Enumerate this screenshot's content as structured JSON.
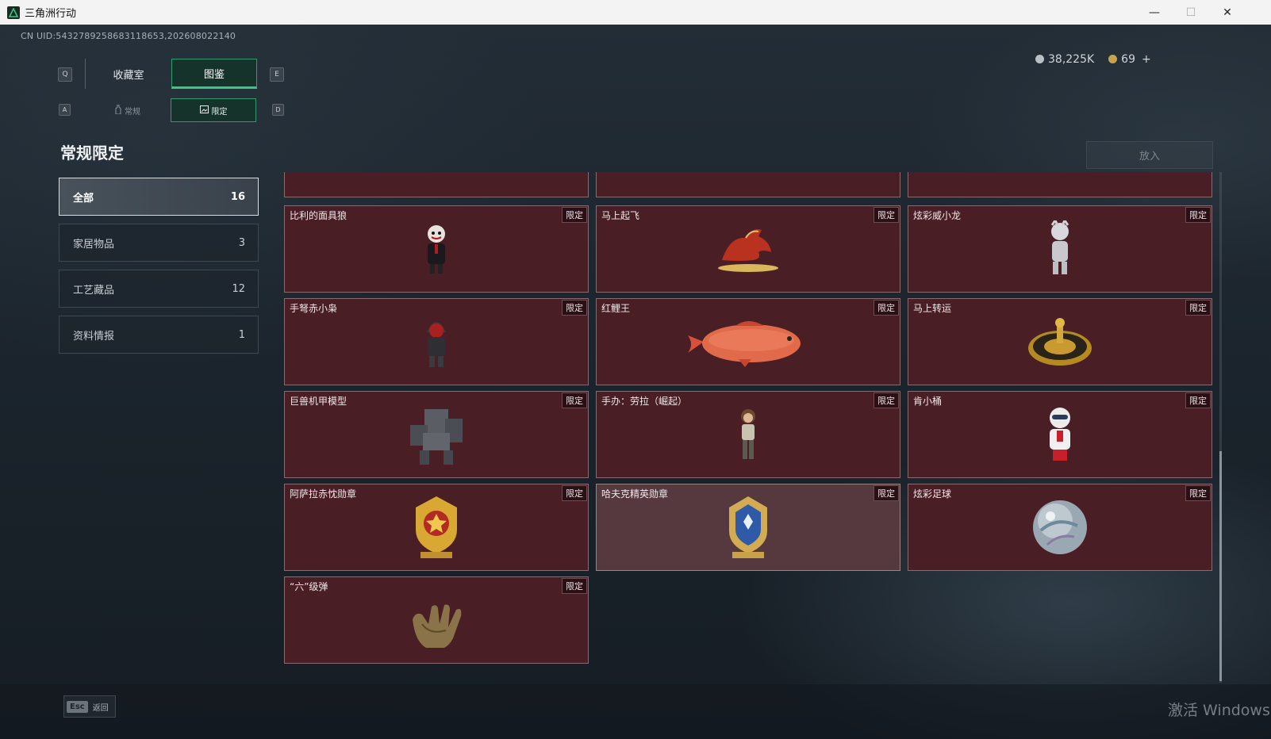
{
  "window": {
    "title": "三角洲行动",
    "minimize": "—",
    "maximize": "☐",
    "close": "✕"
  },
  "uid": "CN UID:5432789258683118653,202608022140",
  "keys": {
    "q": "Q",
    "e": "E",
    "a": "A",
    "d": "D"
  },
  "tabs": [
    {
      "label": "收藏室",
      "active": false
    },
    {
      "label": "图鉴",
      "active": true
    }
  ],
  "subtabs": [
    {
      "label": "常规",
      "icon": "bottle-icon",
      "active": false
    },
    {
      "label": "限定",
      "icon": "image-frame-icon",
      "active": true
    }
  ],
  "currency": {
    "silver": "38,225K",
    "gold": "69",
    "add": "+",
    "colors": {
      "silver": "#b9c1c7",
      "gold": "#c9a24a"
    }
  },
  "section_title": "常规限定",
  "place_button": "放入",
  "categories": [
    {
      "label": "全部",
      "count": "16",
      "active": true
    },
    {
      "label": "家居物品",
      "count": "3",
      "active": false
    },
    {
      "label": "工艺藏品",
      "count": "12",
      "active": false
    },
    {
      "label": "资料情报",
      "count": "1",
      "active": false
    }
  ],
  "items": [
    {
      "name": "比利的面具狼",
      "badge": "限定",
      "icon": "puppet-figure-icon"
    },
    {
      "name": "马上起飞",
      "badge": "限定",
      "icon": "red-horse-icon"
    },
    {
      "name": "炫彩威小龙",
      "badge": "限定",
      "icon": "white-dragon-figure-icon"
    },
    {
      "name": "手弩赤小枭",
      "badge": "限定",
      "icon": "hooded-figure-icon"
    },
    {
      "name": "红鲤王",
      "badge": "限定",
      "icon": "red-carp-icon"
    },
    {
      "name": "马上转运",
      "badge": "限定",
      "icon": "golden-wheel-icon"
    },
    {
      "name": "巨兽机甲模型",
      "badge": "限定",
      "icon": "mech-model-icon"
    },
    {
      "name": "手办：劳拉（崛起）",
      "badge": "限定",
      "icon": "lara-figure-icon"
    },
    {
      "name": "肯小桶",
      "badge": "限定",
      "icon": "colonel-figure-icon"
    },
    {
      "name": "阿萨拉赤忱勋章",
      "badge": "限定",
      "icon": "gold-medal-icon"
    },
    {
      "name": "哈夫克精英勋章",
      "badge": "限定",
      "icon": "blue-medal-icon",
      "highlighted": true
    },
    {
      "name": "炫彩足球",
      "badge": "限定",
      "icon": "iridescent-ball-icon"
    },
    {
      "name": "“六”级弹",
      "badge": "限定",
      "icon": "gold-hand-icon"
    }
  ],
  "bottom": {
    "esc_key": "Esc",
    "esc_label": "返回"
  },
  "watermark": "激活 Windows",
  "colors": {
    "accent": "#3cc58a",
    "card_bg": "#4a1e25",
    "card_border": "#8a6a6e"
  }
}
